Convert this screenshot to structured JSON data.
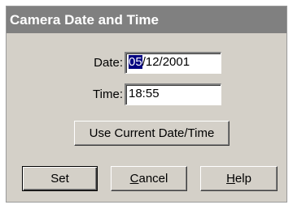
{
  "window": {
    "title": "Camera Date and Time"
  },
  "date": {
    "label": "Date:",
    "selected": "05",
    "rest": "/12/2001"
  },
  "time": {
    "label": "Time:",
    "value": "18:55"
  },
  "buttons": {
    "use_current": "Use Current Date/Time",
    "set": "Set",
    "cancel_mnemonic": "C",
    "cancel_rest": "ancel",
    "help_mnemonic": "H",
    "help_rest": "elp"
  }
}
